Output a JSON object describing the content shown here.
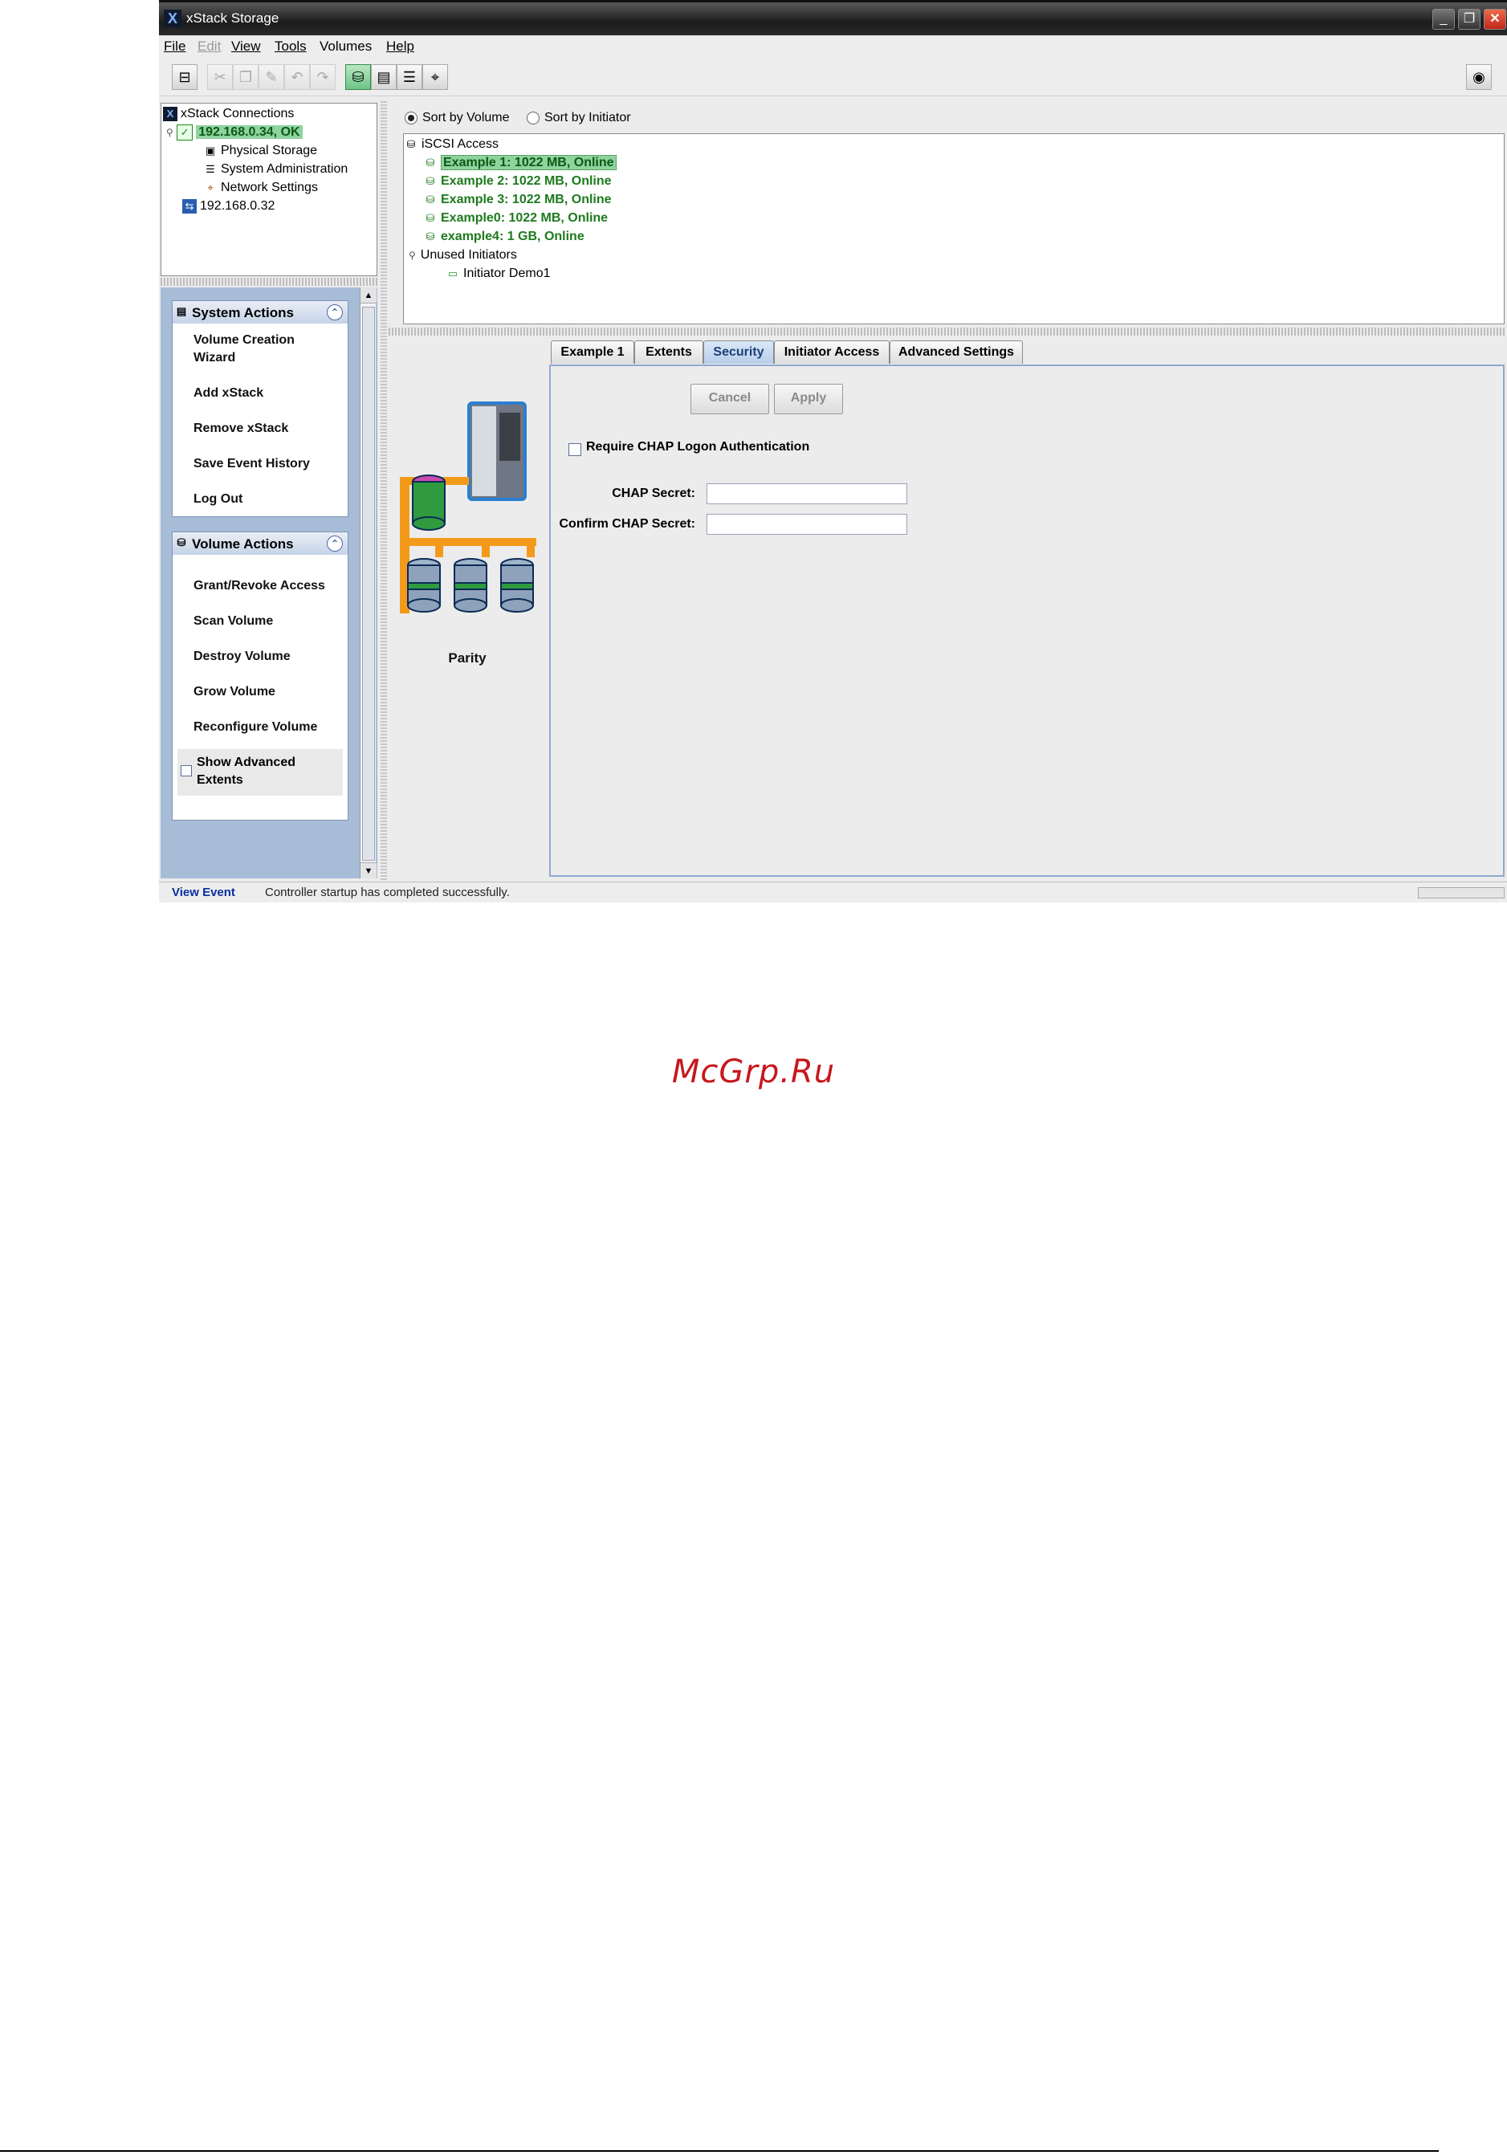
{
  "window": {
    "title": "xStack Storage"
  },
  "menu": [
    {
      "label": "File",
      "enabled": true
    },
    {
      "label": "Edit",
      "enabled": false
    },
    {
      "label": "View",
      "enabled": true
    },
    {
      "label": "Tools",
      "enabled": true
    },
    {
      "label": "Volumes",
      "enabled": true
    },
    {
      "label": "Help",
      "enabled": true
    }
  ],
  "toolbar": {
    "icons": [
      "connect-icon",
      "cut-icon",
      "copy-icon",
      "paste-icon",
      "undo-icon",
      "redo-icon",
      "iscsi-icon",
      "storage-icon",
      "admin-icon",
      "network-icon",
      "help-icon"
    ]
  },
  "connections": {
    "root": "xStack Connections",
    "nodes": [
      {
        "label": "192.168.0.34, OK",
        "selected": true
      },
      {
        "label": "Physical Storage"
      },
      {
        "label": "System Administration"
      },
      {
        "label": "Network Settings"
      },
      {
        "label": "192.168.0.32"
      }
    ]
  },
  "system_actions": {
    "title": "System Actions",
    "items": [
      "Volume Creation Wizard",
      "Add xStack",
      "Remove xStack",
      "Save Event History",
      "Log Out"
    ]
  },
  "volume_actions": {
    "title": "Volume Actions",
    "items": [
      "Grant/Revoke Access",
      "Scan Volume",
      "Destroy Volume",
      "Grow Volume",
      "Reconfigure Volume"
    ],
    "advanced_label": "Show Advanced Extents",
    "advanced_checked": false
  },
  "sort": {
    "by_volume": "Sort by Volume",
    "by_initiator": "Sort by Initiator",
    "selected": "by_volume"
  },
  "iscsi_tree": {
    "root": "iSCSI Access",
    "volumes": [
      "Example 1: 1022 MB, Online",
      "Example 2: 1022 MB, Online",
      "Example 3: 1022 MB, Online",
      "Example0: 1022 MB, Online",
      "example4: 1 GB, Online"
    ],
    "unused_label": "Unused Initiators",
    "initiators": [
      "Initiator Demo1"
    ]
  },
  "detail": {
    "illustration_label": "Parity",
    "tabs": [
      "Example 1",
      "Extents",
      "Security",
      "Initiator Access",
      "Advanced Settings"
    ],
    "active_tab": "Security",
    "cancel_label": "Cancel",
    "apply_label": "Apply",
    "require_chap_label": "Require CHAP Logon Authentication",
    "require_chap_checked": false,
    "chap_secret_label": "CHAP Secret:",
    "chap_secret_value": "",
    "confirm_secret_label": "Confirm CHAP Secret:",
    "confirm_secret_value": ""
  },
  "status": {
    "view_event": "View Event",
    "message": "Controller startup has completed successfully."
  },
  "page": {
    "watermark": "McGrp.Ru"
  },
  "colors": {
    "online_volume": "#1d7a1d",
    "selection": "#8fd39e",
    "panel_blue": "#a7bcd6",
    "link_blue": "#0a2ea3",
    "watermark_red": "#c8161d"
  }
}
